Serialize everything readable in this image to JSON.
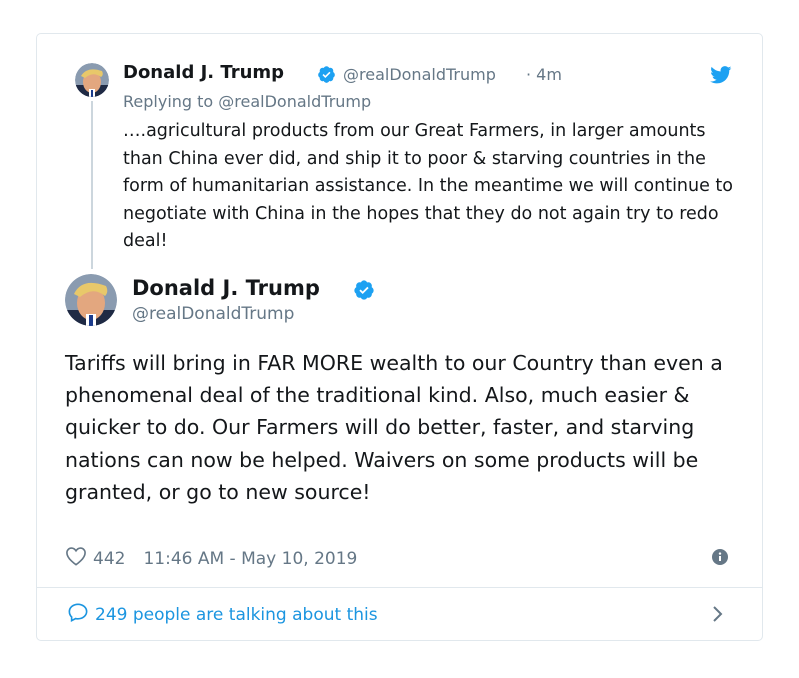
{
  "parent_tweet": {
    "author_name": "Donald J. Trump",
    "handle": "@realDonaldTrump",
    "time": "· 4m",
    "replying_to": "Replying to @realDonaldTrump",
    "text": "….agricultural products from our Great Farmers, in larger amounts than China ever did, and ship it to poor & starving countries in the form of humanitarian assistance. In the meantime we will continue to negotiate with China in the hopes that they do not again try to redo deal!"
  },
  "main_tweet": {
    "author_name": "Donald J. Trump",
    "handle": "@realDonaldTrump",
    "text": "Tariffs will bring in FAR MORE wealth to our Country than even a phenomenal deal of the traditional kind. Also, much easier & quicker to do. Our Farmers will do better, faster, and starving nations can now be helped. Waivers on some products will be granted, or go to new source!",
    "likes": "442",
    "timestamp": "11:46 AM - May 10, 2019"
  },
  "footer": {
    "talking_label": "249 people are talking about this"
  },
  "icons": {
    "verified": "verified-badge-icon",
    "bird": "twitter-bird-icon",
    "heart": "heart-icon",
    "info": "info-icon",
    "bubble": "speech-bubble-icon",
    "chevron": "chevron-right-icon"
  },
  "colors": {
    "accent": "#1da1f2",
    "link": "#1b95e0",
    "muted": "#657786",
    "text": "#14171a",
    "border": "#e1e8ed"
  }
}
